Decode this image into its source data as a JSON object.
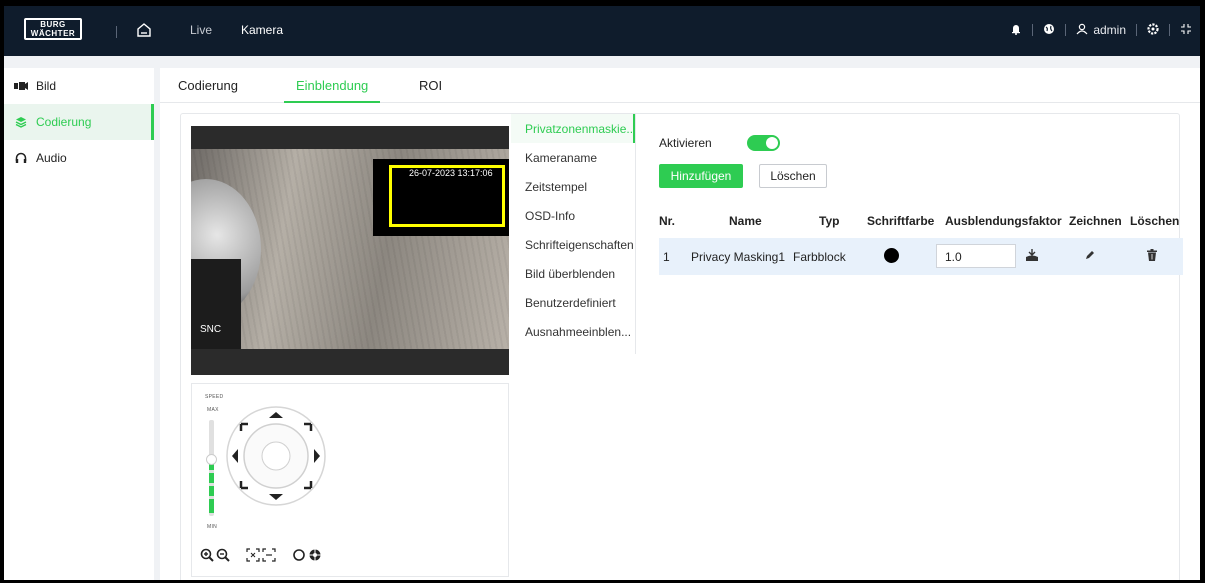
{
  "topbar": {
    "logo_line1": "BURG",
    "logo_line2": "WÄCHTER",
    "nav_live": "Live",
    "nav_kamera": "Kamera",
    "user": "admin"
  },
  "sidebar": {
    "items": [
      {
        "label": "Bild",
        "icon": "camera-icon"
      },
      {
        "label": "Codierung",
        "icon": "layers-icon",
        "active": true
      },
      {
        "label": "Audio",
        "icon": "headphones-icon"
      }
    ]
  },
  "tabs": [
    {
      "label": "Codierung"
    },
    {
      "label": "Einblendung",
      "active": true
    },
    {
      "label": "ROI"
    }
  ],
  "video": {
    "timestamp": "26-07-2023 13:17:06",
    "channel_name": "SNC"
  },
  "ptz": {
    "speed_label": "SPEED",
    "max_label": "MAX",
    "min_label": "MIN",
    "speed_level": 0.55
  },
  "submenu": {
    "items": [
      {
        "label": "Privatzonenmaskie...",
        "active": true
      },
      {
        "label": "Kameraname"
      },
      {
        "label": "Zeitstempel"
      },
      {
        "label": "OSD-Info"
      },
      {
        "label": "Schrifteigenschaften"
      },
      {
        "label": "Bild überblenden"
      },
      {
        "label": "Benutzerdefiniert"
      },
      {
        "label": "Ausnahmeeinblen..."
      }
    ]
  },
  "settings": {
    "enable_label": "Aktivieren",
    "enabled": true,
    "add_label": "Hinzufügen",
    "delete_label": "Löschen",
    "table": {
      "headers": [
        "Nr.",
        "Name",
        "Typ",
        "Schriftfarbe",
        "Ausblendungsfaktor",
        "Zeichnen",
        "Löschen"
      ],
      "rows": [
        {
          "nr": "1",
          "name": "Privacy Masking1",
          "typ": "Farbblock",
          "color": "#000000",
          "factor": "1.0"
        }
      ]
    }
  },
  "colors": {
    "accent": "#2ecc52",
    "topbar": "#0f1c2c",
    "mask_border": "#ffff00"
  }
}
